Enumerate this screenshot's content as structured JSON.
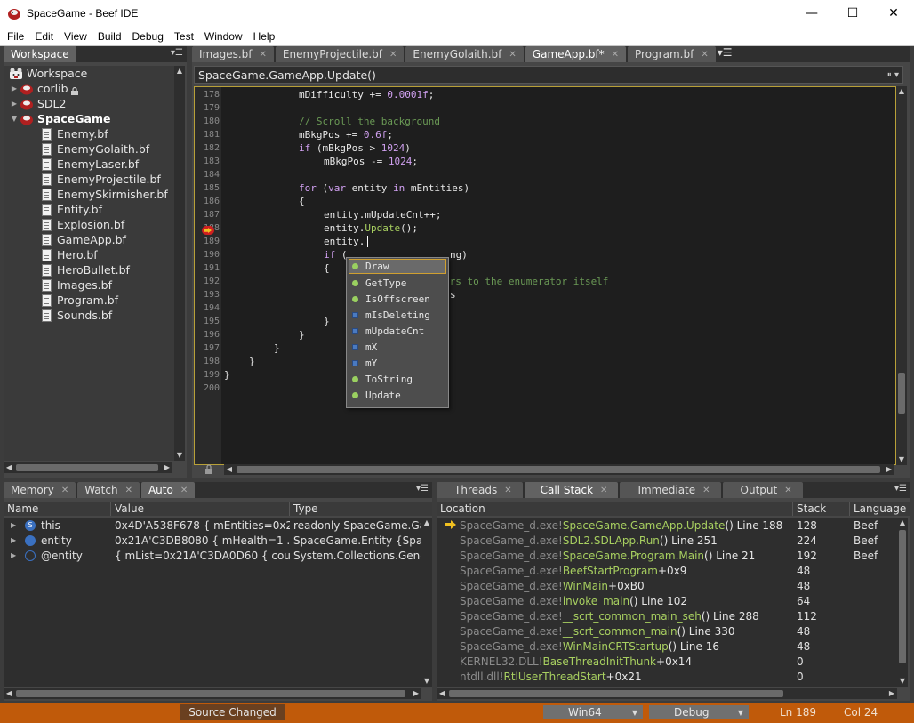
{
  "window": {
    "title": "SpaceGame - Beef IDE",
    "minimize": "—",
    "maximize": "☐",
    "close": "✕"
  },
  "menu": [
    "File",
    "Edit",
    "View",
    "Build",
    "Debug",
    "Test",
    "Window",
    "Help"
  ],
  "workspace": {
    "tab": "Workspace",
    "root": "Workspace",
    "projects": [
      {
        "name": "corlib",
        "locked": true
      },
      {
        "name": "SDL2"
      },
      {
        "name": "SpaceGame",
        "active": true
      }
    ],
    "files": [
      "Enemy.bf",
      "EnemyGolaith.bf",
      "EnemyLaser.bf",
      "EnemyProjectile.bf",
      "EnemySkirmisher.bf",
      "Entity.bf",
      "Explosion.bf",
      "GameApp.bf",
      "Hero.bf",
      "HeroBullet.bf",
      "Images.bf",
      "Program.bf",
      "Sounds.bf"
    ]
  },
  "editor": {
    "tabs": [
      {
        "label": "Images.bf"
      },
      {
        "label": "EnemyProjectile.bf"
      },
      {
        "label": "EnemyGolaith.bf"
      },
      {
        "label": "GameApp.bf*",
        "active": true
      },
      {
        "label": "Program.bf"
      }
    ],
    "breadcrumb": "SpaceGame.GameApp.Update()",
    "line_numbers": [
      "178",
      "179",
      "180",
      "181",
      "182",
      "183",
      "184",
      "185",
      "186",
      "187",
      "188",
      "189",
      "190",
      "191",
      "192",
      "193",
      "194",
      "195",
      "196",
      "197",
      "198",
      "199",
      "200"
    ],
    "code": {
      "l178a": "mDifficulty += ",
      "l178n": "0.0001f",
      "l178b": ";",
      "l180": "// Scroll the background",
      "l181a": "mBkgPos += ",
      "l181n": "0.6f",
      "l181b": ";",
      "l182k": "if",
      "l182a": " (mBkgPos > ",
      "l182n": "1024",
      "l182b": ")",
      "l183a": "mBkgPos -= ",
      "l183n": "1024",
      "l183b": ";",
      "l185k1": "for",
      "l185a": " (",
      "l185k2": "var",
      "l185b": " entity ",
      "l185k3": "in",
      "l185c": " mEntities)",
      "l186": "{",
      "l187": "entity.mUpdateCnt++;",
      "l188a": "entity.",
      "l188f": "Update",
      "l188b": "();",
      "l189": "entity.",
      "l190k": "if",
      "l190a": " (",
      "l190b": "ng)",
      "l191": "{",
      "l192": "ers to the enumerator itself",
      "l193": "s",
      "l195": "}",
      "l196": "}",
      "l197": "}",
      "l198": "}",
      "l199": "}"
    },
    "autocomplete": [
      {
        "label": "Draw",
        "kind": "method",
        "selected": true
      },
      {
        "label": "GetType",
        "kind": "method"
      },
      {
        "label": "IsOffscreen",
        "kind": "method"
      },
      {
        "label": "mIsDeleting",
        "kind": "field"
      },
      {
        "label": "mUpdateCnt",
        "kind": "field"
      },
      {
        "label": "mX",
        "kind": "field"
      },
      {
        "label": "mY",
        "kind": "field"
      },
      {
        "label": "ToString",
        "kind": "method"
      },
      {
        "label": "Update",
        "kind": "method"
      }
    ]
  },
  "watch_panel": {
    "tabs": [
      {
        "label": "Memory"
      },
      {
        "label": "Watch"
      },
      {
        "label": "Auto",
        "active": true
      }
    ],
    "columns": [
      "Name",
      "Value",
      "Type"
    ],
    "rows": [
      {
        "name": "this",
        "value": "0x4D'A538F678 { mEntities=0x2...",
        "type": "readonly SpaceGame.Ga"
      },
      {
        "name": "entity",
        "value": "0x21A'C3DB8080 { mHealth=1 ...",
        "type": "SpaceGame.Entity {Spac"
      },
      {
        "name": "@entity",
        "value": "{ mList=0x21A'C3DA0D60 { cou...",
        "type": "System.Collections.Gene"
      }
    ]
  },
  "callstack_panel": {
    "tabs": [
      {
        "label": "Threads"
      },
      {
        "label": "Call Stack",
        "active": true
      },
      {
        "label": "Immediate"
      },
      {
        "label": "Output"
      }
    ],
    "columns": [
      "Location",
      "Stack",
      "Language"
    ],
    "rows": [
      {
        "module": "SpaceGame_d.exe!",
        "fn": "SpaceGame.GameApp.Update",
        "rest": "() Line 188",
        "stack": "128",
        "lang": "Beef",
        "current": true
      },
      {
        "module": "SpaceGame_d.exe!",
        "fn": "SDL2.SDLApp.Run",
        "rest": "() Line 251",
        "stack": "224",
        "lang": "Beef"
      },
      {
        "module": "SpaceGame_d.exe!",
        "fn": "SpaceGame.Program.Main",
        "rest": "() Line 21",
        "stack": "192",
        "lang": "Beef"
      },
      {
        "module": "SpaceGame_d.exe!",
        "fn": "BeefStartProgram",
        "rest": "+0x9",
        "stack": "48",
        "lang": ""
      },
      {
        "module": "SpaceGame_d.exe!",
        "fn": "WinMain",
        "rest": "+0xB0",
        "stack": "48",
        "lang": ""
      },
      {
        "module": "SpaceGame_d.exe!",
        "fn": "invoke_main",
        "rest": "() Line 102",
        "stack": "64",
        "lang": ""
      },
      {
        "module": "SpaceGame_d.exe!",
        "fn": "__scrt_common_main_seh",
        "rest": "() Line 288",
        "stack": "112",
        "lang": ""
      },
      {
        "module": "SpaceGame_d.exe!",
        "fn": "__scrt_common_main",
        "rest": "() Line 330",
        "stack": "48",
        "lang": ""
      },
      {
        "module": "SpaceGame_d.exe!",
        "fn": "WinMainCRTStartup",
        "rest": "() Line 16",
        "stack": "48",
        "lang": ""
      },
      {
        "module": "KERNEL32.DLL!",
        "fn": "BaseThreadInitThunk",
        "rest": "+0x14",
        "stack": "0",
        "lang": ""
      },
      {
        "module": "ntdll.dll!",
        "fn": "RtlUserThreadStart",
        "rest": "+0x21",
        "stack": "0",
        "lang": ""
      }
    ]
  },
  "status": {
    "source_changed": "Source Changed",
    "platform": "Win64",
    "config": "Debug",
    "line": "Ln 189",
    "col": "Col 24"
  },
  "colors": {
    "status_bar": "#c05a0a",
    "accent_border": "#b8a038",
    "method_fn": "#a8d060"
  },
  "icons": [
    "app-icon",
    "lock-icon",
    "project-icon",
    "file-icon",
    "breakpoint-arrow-icon",
    "method-icon",
    "field-icon",
    "dropdown-icon",
    "tab-menu-icon"
  ]
}
